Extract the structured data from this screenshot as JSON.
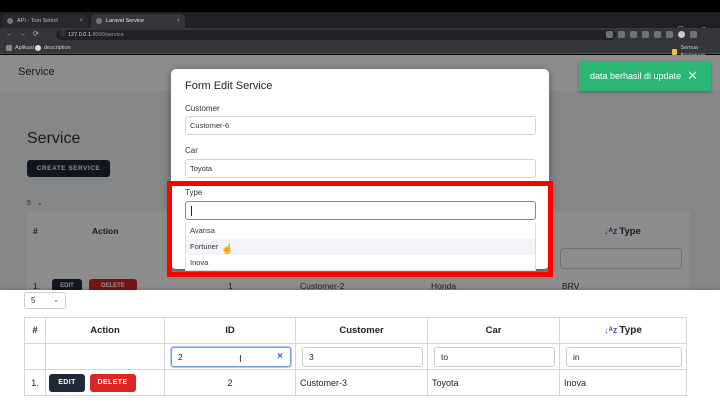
{
  "browser": {
    "tabs": [
      {
        "label": "API - Tom Select",
        "close": "×"
      },
      {
        "label": "Laravel Service",
        "close": "×"
      }
    ],
    "new_tab": "+",
    "window_controls": "– ▢ ×",
    "nav": {
      "back": "←",
      "forward": "→",
      "reload": "⟳"
    },
    "url_host": "127.0.0.1",
    "url_path": ":8000/service",
    "bookmarks": {
      "apps": "Aplikasi",
      "description": "description",
      "all": "Semua Bookmark"
    }
  },
  "background": {
    "brand": "Service",
    "title": "Service",
    "create_button": "CREATE SERVICE",
    "per_page": "5",
    "headers": {
      "no": "#",
      "action": "Action",
      "type": "Type"
    },
    "row": {
      "no": "1.",
      "edit": "EDIT",
      "delete": "DELETE",
      "id": "1",
      "customer": "Customer-2",
      "car": "Honda",
      "type": "BRV"
    }
  },
  "modal": {
    "title": "Form Edit Service",
    "customer_label": "Customer",
    "customer_value": "Customer-6",
    "car_label": "Car",
    "car_value": "Toyota",
    "type_label": "Type",
    "type_options": [
      "Avansa",
      "Fortuner",
      "Inova"
    ],
    "hovered_option": "Fortuner"
  },
  "toast": {
    "message": "data berhasil di update",
    "close": "✕"
  },
  "table": {
    "per_page": "5",
    "sort_icon": "↓ᴬz",
    "columns": [
      "#",
      "Action",
      "ID",
      "Customer",
      "Car",
      "Type"
    ],
    "filters": {
      "id": "2",
      "customer": "3",
      "car": "to",
      "type": "in",
      "clear": "×"
    },
    "rows": [
      {
        "no": "1.",
        "edit": "EDIT",
        "delete": "DELETE",
        "id": "2",
        "customer": "Customer-3",
        "car": "Toyota",
        "type": "Inova"
      }
    ]
  },
  "colors": {
    "highlight": "#ff0000",
    "toast": "#2bb673",
    "edit_button": "#1f2937",
    "delete_button": "#dc2626",
    "sort_icon": "#6b46c1"
  }
}
